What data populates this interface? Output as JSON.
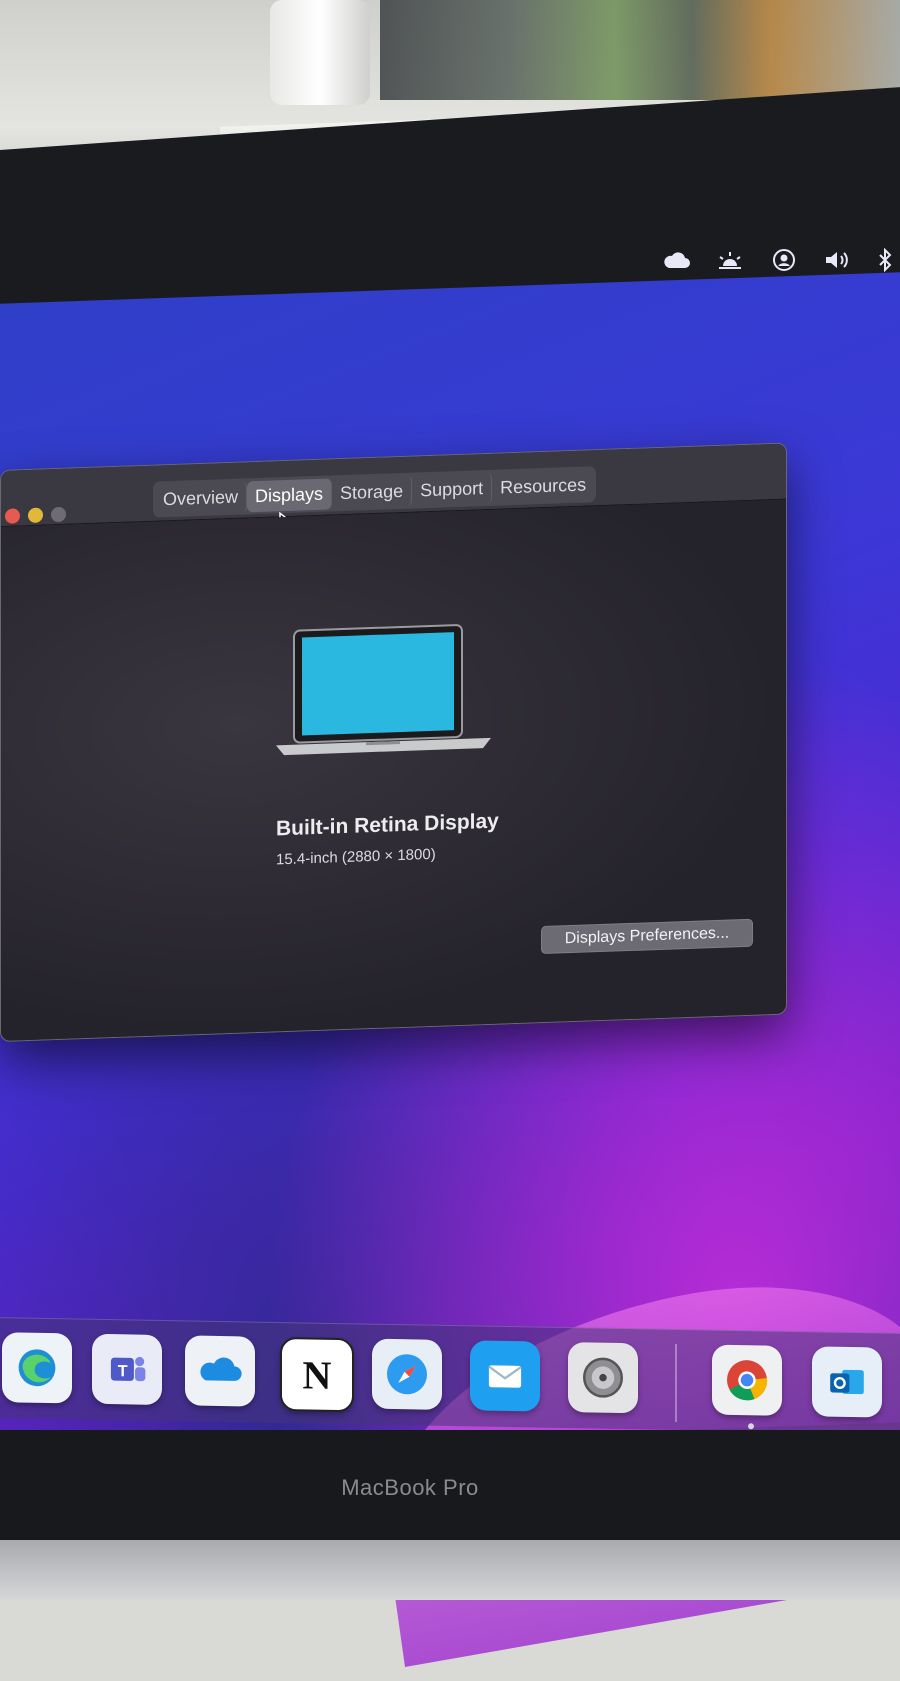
{
  "window": {
    "tabs": [
      {
        "label": "Overview",
        "active": false
      },
      {
        "label": "Displays",
        "active": true
      },
      {
        "label": "Storage",
        "active": false
      },
      {
        "label": "Support",
        "active": false
      },
      {
        "label": "Resources",
        "active": false
      }
    ],
    "display_name": "Built-in Retina Display",
    "display_spec": "15.4-inch (2880 × 1800)",
    "preferences_button": "Displays Preferences..."
  },
  "menubar_icons": [
    "icloud-icon",
    "brightness-icon",
    "user-icon",
    "volume-icon",
    "bluetooth-icon"
  ],
  "dock_icons": [
    "edge-icon",
    "teams-icon",
    "onedrive-icon",
    "notion-icon",
    "safari-icon",
    "mail-icon",
    "system-preferences-icon",
    "chrome-icon",
    "outlook-icon"
  ],
  "device_label": "MacBook Pro",
  "colors": {
    "desktop": "#3a39d6",
    "accent_purple": "#b72cd6",
    "window_bg": "#2c2a31"
  }
}
